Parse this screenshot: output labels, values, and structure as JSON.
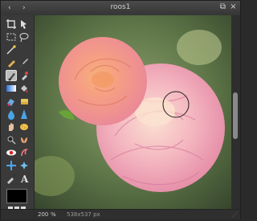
{
  "window": {
    "title": "roos1",
    "nav_back": "‹",
    "nav_forward": "›",
    "maximize_glyph": "⧉",
    "close_glyph": "×"
  },
  "tools": [
    "crop-icon",
    "move-icon",
    "marquee-select-icon",
    "lasso-icon",
    "magic-wand-icon",
    "pencil-icon",
    "brush-icon",
    "color-replace-icon",
    "gradient-icon",
    "paint-bucket-icon",
    "clone-stamp-icon",
    "eraser-icon",
    "blur-icon",
    "sharpen-icon",
    "smudge-icon",
    "sponge-icon",
    "dodge-icon",
    "burn-icon",
    "red-eye-icon",
    "bloat-icon",
    "pinch-icon",
    "spherize-icon",
    "eyedropper-icon",
    "text-icon",
    "hand-icon",
    "zoom-icon"
  ],
  "status": {
    "zoom": "200",
    "zoom_unit": "%",
    "dimensions": "538x537 px",
    "resize_glyph": "⋰"
  },
  "colors": {
    "foreground": "#000000",
    "background": "#ffffff",
    "accent": "#bdbdbd"
  }
}
